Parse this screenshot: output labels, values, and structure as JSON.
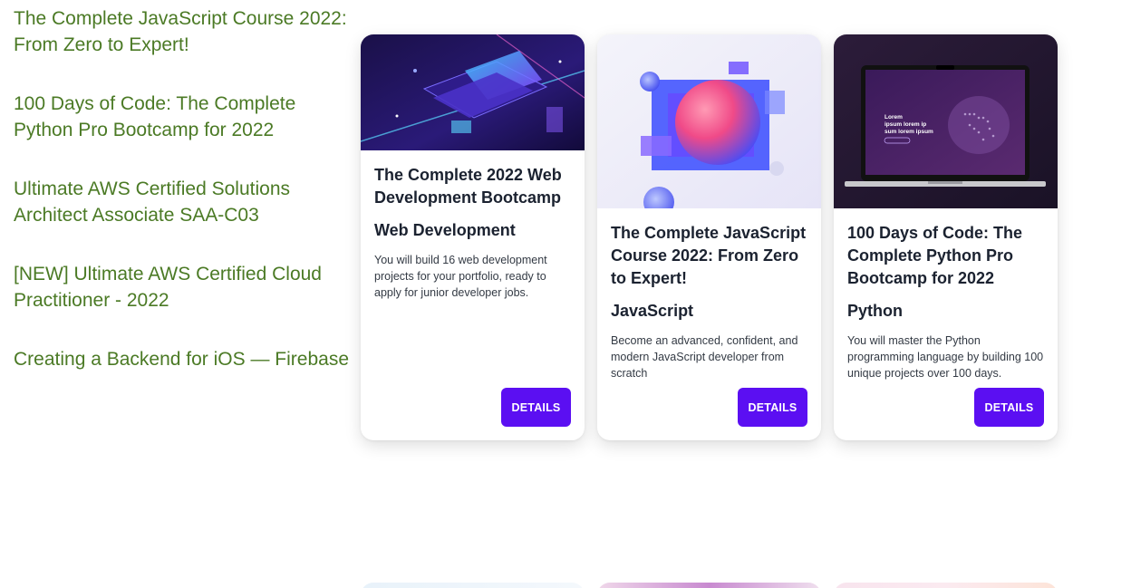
{
  "sidebar": {
    "links": [
      "The Complete JavaScript Course 2022: From Zero to Expert!",
      "100 Days of Code: The Complete Python Pro Bootcamp for 2022",
      "Ultimate AWS Certified Solutions Architect Associate SAA-C03",
      "[NEW] Ultimate AWS Certified Cloud Practitioner - 2022",
      "Creating a Backend for iOS — Firebase"
    ]
  },
  "cards": [
    {
      "title": "The Complete 2022 Web Development Bootcamp",
      "category": "Web Development",
      "description": "You will build 16 web development projects for your portfolio, ready to apply for junior developer jobs.",
      "button": "DETAILS"
    },
    {
      "title": "The Complete JavaScript Course 2022: From Zero to Expert!",
      "category": "JavaScript",
      "description": "Become an advanced, confident, and modern JavaScript developer from scratch",
      "button": "DETAILS"
    },
    {
      "title": "100 Days of Code: The Complete Python Pro Bootcamp for 2022",
      "category": "Python",
      "description": "You will master the Python programming language by building 100 unique projects over 100 days.",
      "button": "DETAILS",
      "image_text": [
        "Lorem",
        "ipsum lorem ip",
        "sum lorem ipsum"
      ]
    }
  ],
  "colors": {
    "link": "#4b7a25",
    "button": "#5b0ff2",
    "heading": "#1b2230"
  }
}
